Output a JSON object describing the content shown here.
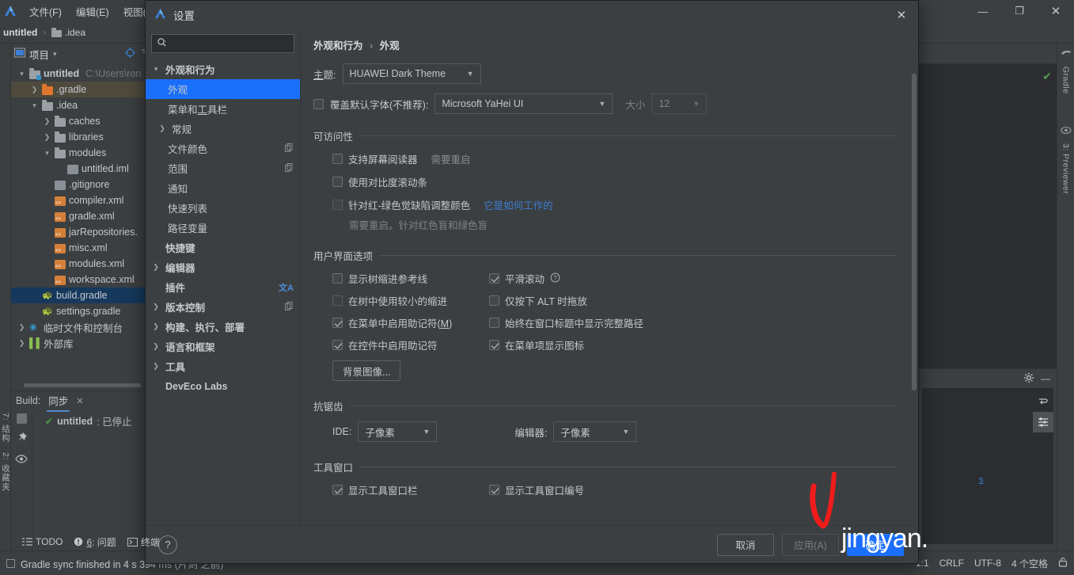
{
  "ide": {
    "menu": [
      {
        "label": "文件(F)",
        "mnemonic": "F"
      },
      {
        "label": "编辑(E)",
        "mnemonic": "E"
      },
      {
        "label": "视图(V)",
        "mnemonic": "V"
      }
    ],
    "window_controls": {
      "minimize": "—",
      "maximize": "❐",
      "close": "✕"
    },
    "breadcrumb": {
      "project": "untitled",
      "separator": "›",
      "item": ".idea"
    },
    "project_panel": {
      "title": "项目",
      "dropdown_arrow": "▾",
      "tree": [
        {
          "depth": 0,
          "arrow": "v",
          "icon": "folder-module",
          "label": "untitled",
          "bold": true,
          "path": "C:\\Users\\ron",
          "state": "normal"
        },
        {
          "depth": 1,
          "arrow": ">",
          "icon": "folder-orange",
          "label": ".gradle",
          "state": "highlight"
        },
        {
          "depth": 1,
          "arrow": "v",
          "icon": "folder",
          "label": ".idea",
          "state": "normal"
        },
        {
          "depth": 2,
          "arrow": ">",
          "icon": "folder",
          "label": "caches",
          "state": "normal"
        },
        {
          "depth": 2,
          "arrow": ">",
          "icon": "folder",
          "label": "libraries",
          "state": "normal"
        },
        {
          "depth": 2,
          "arrow": "v",
          "icon": "folder",
          "label": "modules",
          "state": "normal"
        },
        {
          "depth": 3,
          "arrow": "",
          "icon": "iml",
          "label": "untitled.iml",
          "state": "normal"
        },
        {
          "depth": 2,
          "arrow": "",
          "icon": "git",
          "label": ".gitignore",
          "state": "normal"
        },
        {
          "depth": 2,
          "arrow": "",
          "icon": "xml",
          "label": "compiler.xml",
          "state": "normal"
        },
        {
          "depth": 2,
          "arrow": "",
          "icon": "xml",
          "label": "gradle.xml",
          "state": "normal"
        },
        {
          "depth": 2,
          "arrow": "",
          "icon": "xml",
          "label": "jarRepositories.",
          "state": "normal"
        },
        {
          "depth": 2,
          "arrow": "",
          "icon": "xml",
          "label": "misc.xml",
          "state": "normal"
        },
        {
          "depth": 2,
          "arrow": "",
          "icon": "xml",
          "label": "modules.xml",
          "state": "normal"
        },
        {
          "depth": 2,
          "arrow": "",
          "icon": "xml",
          "label": "workspace.xml",
          "state": "normal"
        },
        {
          "depth": 1,
          "arrow": "",
          "icon": "gradle",
          "label": "build.gradle",
          "state": "selected"
        },
        {
          "depth": 1,
          "arrow": "",
          "icon": "gradle",
          "label": "settings.gradle",
          "state": "normal"
        },
        {
          "depth": 0,
          "arrow": ">",
          "icon": "scratch",
          "label": "临时文件和控制台",
          "state": "normal"
        },
        {
          "depth": 0,
          "arrow": ">",
          "icon": "lib",
          "label": "外部库",
          "state": "normal"
        }
      ]
    },
    "build_panel": {
      "label": "Build:",
      "tab": "同步",
      "close": "✕",
      "item": {
        "check": "✔",
        "name": "untitled",
        "status": ": 已停止"
      }
    },
    "left_rail": [
      "7: 结构",
      "2: 收藏夹"
    ],
    "right_rail": [
      "Gradle",
      "3: Previewer"
    ],
    "tool_tabs": [
      {
        "icon": "todo-icon",
        "label": "TODO"
      },
      {
        "icon": "error-icon",
        "label": "6: 问题",
        "mnemonic": "6"
      },
      {
        "icon": "terminal-icon",
        "label": "终端"
      }
    ],
    "statusbar": {
      "message": "Gradle sync finished in 4 s 394 ms (片刻 之前)",
      "caret": "1:1",
      "line_ending": "CRLF",
      "encoding": "UTF-8",
      "indent": "4 个空格",
      "lock_icon": "🔒"
    },
    "lower_right": {
      "gear": "gear-icon",
      "minimize": "—",
      "link": "s"
    }
  },
  "dialog": {
    "title": "设置",
    "close": "✕",
    "search": {
      "placeholder": "",
      "value": "",
      "icon": "search-icon"
    },
    "categories": [
      {
        "depth": 0,
        "arrow": "v",
        "label": "外观和行为",
        "selected": false,
        "bold": true
      },
      {
        "depth": 1,
        "arrow": "",
        "label": "外观",
        "selected": true
      },
      {
        "depth": 1,
        "arrow": "",
        "label": "菜单和工具栏",
        "selected": false,
        "mnemonic": "工"
      },
      {
        "depth": 1,
        "arrow": ">",
        "label": "常规",
        "selected": false,
        "indentArrow": true
      },
      {
        "depth": 1,
        "arrow": "",
        "label": "文件颜色",
        "selected": false,
        "trail": "copy-icon"
      },
      {
        "depth": 1,
        "arrow": "",
        "label": "范围",
        "selected": false,
        "trail": "copy-icon"
      },
      {
        "depth": 1,
        "arrow": "",
        "label": "通知",
        "selected": false
      },
      {
        "depth": 1,
        "arrow": "",
        "label": "快速列表",
        "selected": false
      },
      {
        "depth": 1,
        "arrow": "",
        "label": "路径变量",
        "selected": false
      },
      {
        "depth": 0,
        "arrow": "",
        "label": "快捷键",
        "selected": false,
        "bold": true
      },
      {
        "depth": 0,
        "arrow": ">",
        "label": "编辑器",
        "selected": false,
        "bold": true
      },
      {
        "depth": 0,
        "arrow": "",
        "label": "插件",
        "selected": false,
        "bold": true,
        "trail": "translate-icon"
      },
      {
        "depth": 0,
        "arrow": ">",
        "label": "版本控制",
        "selected": false,
        "bold": true,
        "trail": "copy-icon"
      },
      {
        "depth": 0,
        "arrow": ">",
        "label": "构建、执行、部署",
        "selected": false,
        "bold": true
      },
      {
        "depth": 0,
        "arrow": ">",
        "label": "语言和框架",
        "selected": false,
        "bold": true
      },
      {
        "depth": 0,
        "arrow": ">",
        "label": "工具",
        "selected": false,
        "bold": true
      },
      {
        "depth": 0,
        "arrow": "",
        "label": "DevEco Labs",
        "selected": false,
        "bold": true
      }
    ],
    "breadcrumb": {
      "parent": "外观和行为",
      "sep": "›",
      "current": "外观"
    },
    "theme": {
      "label": "主题:",
      "value": "HUAWEI Dark Theme",
      "arrow": "▼"
    },
    "font_override": {
      "checkbox_checked": false,
      "label": "覆盖默认字体(不推荐):",
      "font_value": "Microsoft YaHei UI",
      "size_label": "大小",
      "size_value": "12",
      "arrow": "▼"
    },
    "accessibility": {
      "title": "可访问性",
      "items": [
        {
          "checked": false,
          "label": "支持屏幕阅读器",
          "note": "需要重启",
          "disabled": false
        },
        {
          "checked": false,
          "label": "使用对比度滚动条",
          "note": "",
          "disabled": false
        },
        {
          "checked": false,
          "label": "针对红-绿色觉缺陷调整颜色",
          "link": "它是如何工作的",
          "disabled": true
        }
      ],
      "subnote": "需要重启。针对红色盲和绿色盲"
    },
    "ui_options": {
      "title": "用户界面选项",
      "left": [
        {
          "checked": false,
          "label": "显示树缩进参考线",
          "disabled": false
        },
        {
          "checked": false,
          "label": "在树中使用较小的缩进",
          "disabled": true
        },
        {
          "checked": true,
          "label": "在菜单中启用助记符(M)",
          "mnemonic": "M"
        },
        {
          "checked": true,
          "label": "在控件中启用助记符"
        }
      ],
      "right": [
        {
          "checked": true,
          "label": "平滑滚动",
          "help": "?"
        },
        {
          "checked": false,
          "label": "仅按下 ALT 时拖放"
        },
        {
          "checked": false,
          "label": "始终在窗口标题中显示完整路径"
        },
        {
          "checked": true,
          "label": "在菜单项显示图标"
        }
      ],
      "background_button": "背景图像..."
    },
    "antialiasing": {
      "title": "抗锯齿",
      "ide_label": "IDE:",
      "ide_value": "子像素",
      "editor_label": "编辑器:",
      "editor_value": "子像素",
      "arrow": "▼"
    },
    "toolwindow": {
      "title": "工具窗口",
      "left": {
        "checked": true,
        "label": "显示工具窗口栏"
      },
      "right": {
        "checked": true,
        "label": "显示工具窗口编号"
      }
    },
    "buttons": {
      "cancel": "取消",
      "apply": "应用(A)",
      "ok": "确定"
    },
    "help": "?"
  },
  "watermark": {
    "text": "jingyan."
  },
  "colors": {
    "accent": "#1a6ffa",
    "panel": "#3c3f41",
    "editor_bg": "#2b2d31",
    "link": "#3a7fd5",
    "highlight_row": "#4e4a3d",
    "selected_row": "#15385c",
    "red_annotation": "#f01c1c",
    "green_check": "#4f9e4f"
  }
}
